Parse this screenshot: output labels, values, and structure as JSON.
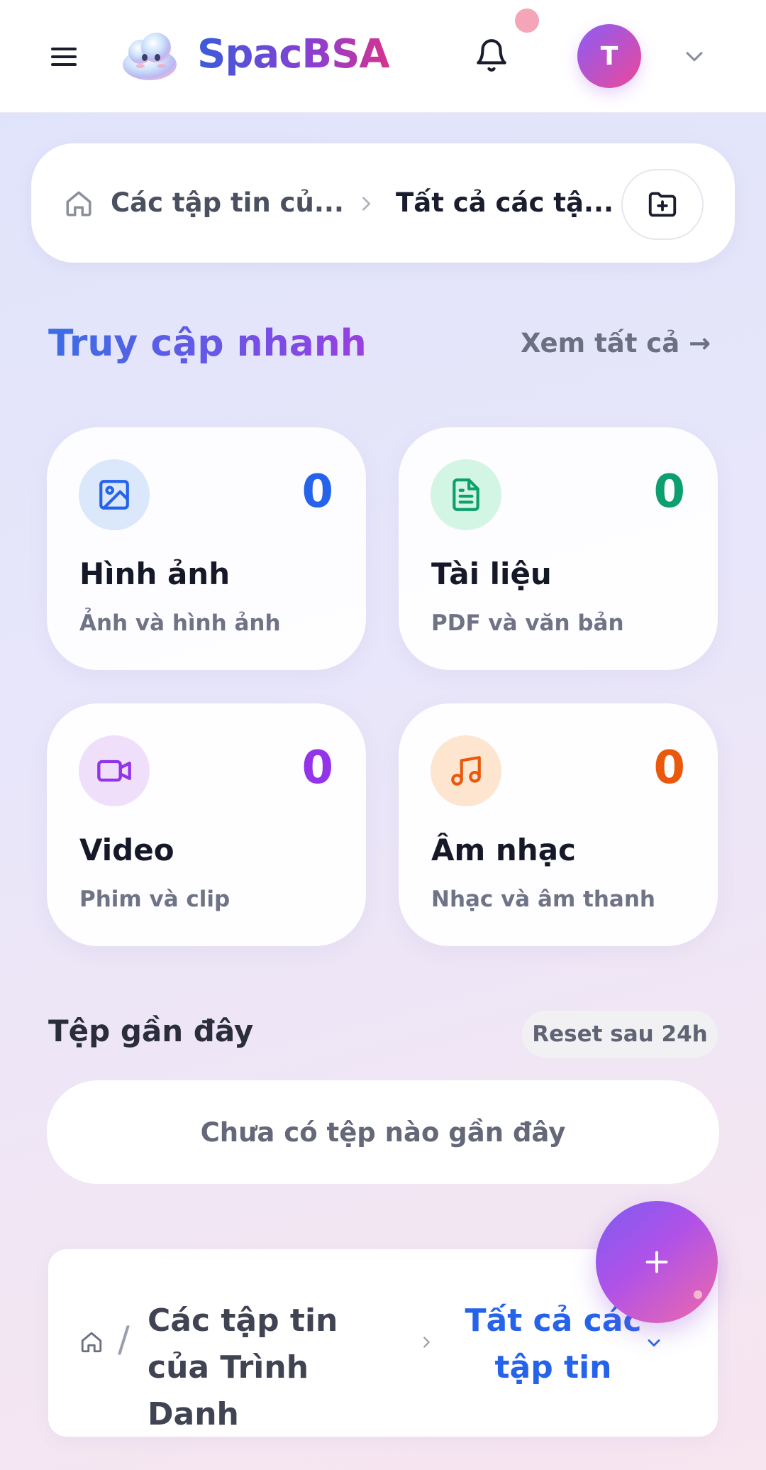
{
  "header": {
    "brand": "SpacBSA",
    "avatar_initial": "T",
    "icons": {
      "menu": "hamburger-icon",
      "bell": "bell-icon",
      "dropdown": "chevron-down-icon"
    }
  },
  "breadcrumb": {
    "root": "Các tập tin củ...",
    "current": "Tất cả các tậ..."
  },
  "quick_access": {
    "title": "Truy cập nhanh",
    "view_all": "Xem tất cả →",
    "cards": [
      {
        "title": "Hình ảnh",
        "subtitle": "Ảnh và hình ảnh",
        "count": "0",
        "icon": "image-icon",
        "color": "#2563eb",
        "bg": "#dbe7fb"
      },
      {
        "title": "Tài liệu",
        "subtitle": "PDF và văn bản",
        "count": "0",
        "icon": "document-icon",
        "color": "#0e9f6e",
        "bg": "#d3f5e4"
      },
      {
        "title": "Video",
        "subtitle": "Phim và clip",
        "count": "0",
        "icon": "video-icon",
        "color": "#9333ea",
        "bg": "#efdffb"
      },
      {
        "title": "Âm nhạc",
        "subtitle": "Nhạc và âm thanh",
        "count": "0",
        "icon": "music-icon",
        "color": "#ea580c",
        "bg": "#fde5cf"
      }
    ]
  },
  "recent": {
    "title": "Tệp gần đây",
    "badge": "Reset sau 24h",
    "empty": "Chưa có tệp nào gần đây"
  },
  "bottom_breadcrumb": {
    "slash": "/",
    "root": "Các tập tin của Trình Danh",
    "current": "Tất cả các tập tin"
  },
  "fab": {
    "label": "+"
  }
}
